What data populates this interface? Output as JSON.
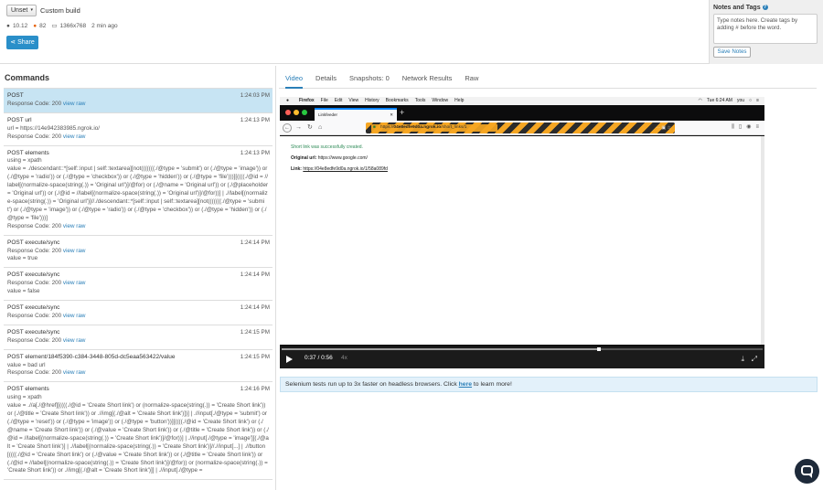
{
  "header": {
    "status_value": "Unset",
    "build_label": "Custom build",
    "os_version": "10.12",
    "browser_version": "82",
    "resolution": "1366x768",
    "time_ago": "2 min ago",
    "share_label": "Share",
    "icons": {
      "os": "apple-icon",
      "browser": "firefox-icon",
      "monitor": "monitor-icon",
      "share": "share-icon"
    }
  },
  "notes": {
    "title": "Notes and Tags",
    "placeholder": "Type notes here. Create tags by adding # before the word.",
    "save_label": "Save Notes"
  },
  "commands": {
    "title": "Commands",
    "items": [
      {
        "name": "POST",
        "time": "1:24:03 PM",
        "body": "",
        "response": "Response Code: 200",
        "link": "view raw",
        "extra": ""
      },
      {
        "name": "POST url",
        "time": "1:24:13 PM",
        "body": "url = https://14e942383985.ngrok.io/",
        "response": "Response Code: 200",
        "link": "view raw",
        "extra": ""
      },
      {
        "name": "POST elements",
        "time": "1:24:13 PM",
        "body": "using = xpath\nvalue = ./descendant::*[self::input | self::textarea][not(((((((./@type = 'submit') or (./@type = 'image')) or (./@type = 'radio')) or (./@type = 'checkbox')) or (./@type = 'hidden')) or (./@type = 'file')))][((((./@id = //label[(normalize-space(string(.)) = 'Original url')]/@for) or (./@name = 'Original url')) or (./@placeholder = 'Original url')) or (./@id = //label[(normalize-space(string(.)) = 'Original url')]/@for))] | .//label[(normalize-space(string(.)) = 'Original url')]//./descendant::*[self::input | self::textarea][not(((((((./@type = 'submit') or (./@type = 'image')) or (./@type = 'radio')) or (./@type = 'checkbox')) or (./@type = 'hidden')) or (./@type = 'file')))]",
        "response": "Response Code: 200",
        "link": "view raw",
        "extra": ""
      },
      {
        "name": "POST execute/sync",
        "time": "1:24:14 PM",
        "body": "",
        "response": "Response Code: 200",
        "link": "view raw",
        "extra": "value = true"
      },
      {
        "name": "POST execute/sync",
        "time": "1:24:14 PM",
        "body": "",
        "response": "Response Code: 200",
        "link": "view raw",
        "extra": "value = false"
      },
      {
        "name": "POST execute/sync",
        "time": "1:24:14 PM",
        "body": "",
        "response": "Response Code: 200",
        "link": "view raw",
        "extra": ""
      },
      {
        "name": "POST execute/sync",
        "time": "1:24:15 PM",
        "body": "",
        "response": "Response Code: 200",
        "link": "view raw",
        "extra": ""
      },
      {
        "name": "POST element/184f5390-c384-3448-805d-dc5eaa563422/value",
        "time": "1:24:15 PM",
        "body": "value = bad url",
        "response": "Response Code: 200",
        "link": "view raw",
        "extra": ""
      },
      {
        "name": "POST elements",
        "time": "1:24:16 PM",
        "body": "using = xpath\nvalue = .//a[./@href][((((./@id = 'Create Short link') or (normalize-space(string(.)) = 'Create Short link')) or (./@title = 'Create Short link')) or .//img[(./@alt = 'Create Short link')])] | .//input[./@type = 'submit') or (./@type = 'reset')) or (./@type = 'image')) or (./@type = 'button'))][((((./@id = 'Create Short link') or (./@name = 'Create Short link')) or (./@value = 'Create Short link')) or (./@title = 'Create Short link')) or (./@id = //label[(normalize-space(string(.)) = 'Create Short link')]/@for))] | .//input[./@type = 'image'][(./@alt = 'Create Short link')] | .//label[(normalize-space(string(.)) = 'Create Short link')]//.//input[...] | .//button[((((./@id = 'Create Short link') or (./@value = 'Create Short link')) or (./@title = 'Create Short link')) or (./@id = //label[(normalize-space(string(.)) = 'Create Short link')]/@for)) or (normalize-space(string(.)) = 'Create Short link')) or .//img[(./@alt = 'Create Short link')]] | .//input[./@type =",
        "response": "",
        "link": "",
        "extra": ""
      }
    ]
  },
  "tabs": [
    {
      "label": "Video"
    },
    {
      "label": "Details"
    },
    {
      "label": "Snapshots: 0"
    },
    {
      "label": "Network Results"
    },
    {
      "label": "Raw"
    }
  ],
  "video": {
    "mac_menu": [
      "Firefox",
      "File",
      "Edit",
      "View",
      "History",
      "Bookmarks",
      "Tools",
      "Window",
      "Help"
    ],
    "mac_clock": "Tue 6:24 AM",
    "mac_user": "you",
    "tab_title": "Linkfeeder",
    "url_scheme": "https://",
    "url_host": "04e8edfe9d0a.ngrok.io",
    "url_path": "/short_links/1",
    "page_success": "Short link was successfully created.",
    "page_orig_label": "Original url:",
    "page_orig_value": "https://www.google.com/",
    "page_link_label": "Link:",
    "page_link_value": "https://04e8edfe9d0a.ngrok.io/1/58a089fd",
    "time_display": "0:37 / 0:56",
    "speed": "4x",
    "progress": 0.66
  },
  "banner": {
    "text_before": "Selenium tests run up to 3x faster on headless browsers. Click ",
    "link": "here",
    "text_after": " to learn more!"
  },
  "colors": {
    "accent": "#2a8fc9",
    "active_row": "#c7e4f3",
    "banner_bg": "#e3f1fa"
  }
}
